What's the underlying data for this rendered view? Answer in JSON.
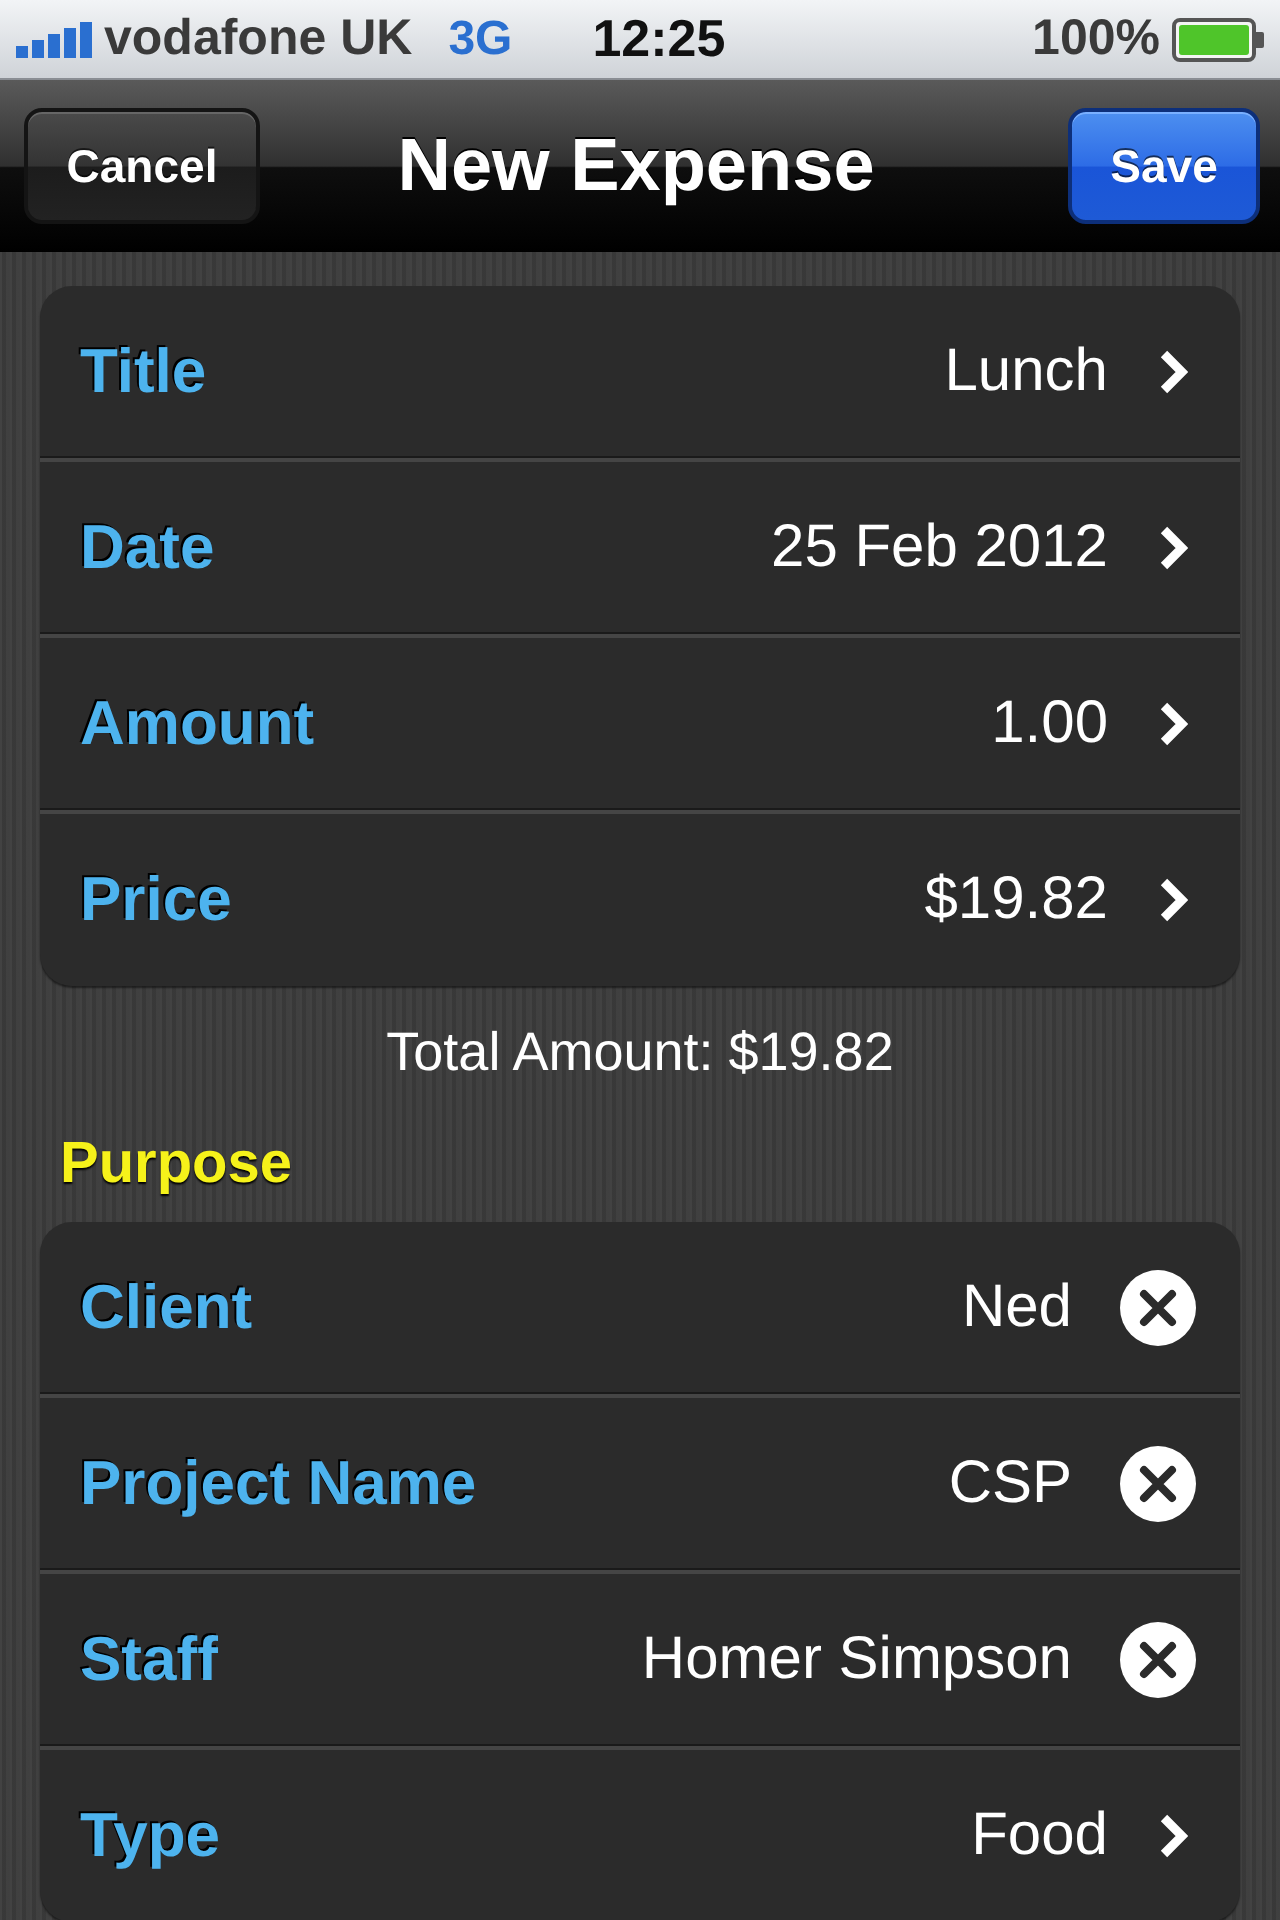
{
  "status_bar": {
    "carrier": "vodafone UK",
    "network": "3G",
    "time": "12:25",
    "battery": "100%"
  },
  "nav_bar": {
    "title": "New Expense",
    "left_button": {
      "label": "Cancel",
      "kind": "plain"
    },
    "right_button": {
      "label": "Save",
      "kind": "done"
    }
  },
  "general": {
    "rows": [
      {
        "label": "Title",
        "value": "Lunch",
        "kind": "disclosure"
      },
      {
        "label": "Date",
        "value": "25 Feb 2012",
        "kind": "disclosure"
      },
      {
        "label": "Amount",
        "value": "1.00",
        "kind": "disclosure"
      },
      {
        "label": "Price",
        "value": "$19.82",
        "kind": "disclosure"
      }
    ],
    "footer": "Total Amount: $19.82"
  },
  "purpose": {
    "header": "Purpose",
    "rows": [
      {
        "label": "Client",
        "value": "Ned",
        "kind": "clear"
      },
      {
        "label": "Project Name",
        "value": "CSP",
        "kind": "clear"
      },
      {
        "label": "Staff",
        "value": "Homer Simpson",
        "kind": "clear"
      },
      {
        "label": "Type",
        "value": "Food",
        "kind": "disclosure"
      }
    ]
  }
}
